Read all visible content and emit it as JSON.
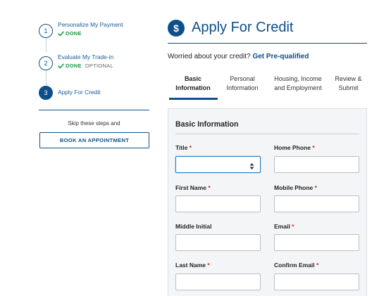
{
  "stepper": {
    "steps": [
      {
        "number": "1",
        "title": "Personalize My Payment",
        "status": "DONE",
        "optional": ""
      },
      {
        "number": "2",
        "title": "Evaluate My Trade-in",
        "status": "DONE",
        "optional": "OPTIONAL"
      },
      {
        "number": "3",
        "title": "Apply For Credit",
        "status": "",
        "optional": ""
      }
    ],
    "skip_text": "Skip these steps and",
    "appointment_button": "BOOK AN APPOINTMENT"
  },
  "header": {
    "icon_symbol": "$",
    "title": "Apply For Credit",
    "worried_text": "Worried about your credit?",
    "prequalified_link": "Get Pre-qualified"
  },
  "tabs": [
    {
      "line1": "Basic",
      "line2": "Information",
      "active": true
    },
    {
      "line1": "Personal",
      "line2": "Information",
      "active": false
    },
    {
      "line1": "Housing, Income",
      "line2": "and Employment",
      "active": false
    },
    {
      "line1": "Review &",
      "line2": "Submit",
      "active": false
    }
  ],
  "form": {
    "section_title": "Basic Information",
    "required_marker": "*",
    "fields": {
      "title": {
        "label": "Title",
        "value": ""
      },
      "home_phone": {
        "label": "Home Phone",
        "value": ""
      },
      "first_name": {
        "label": "First Name",
        "value": ""
      },
      "mobile_phone": {
        "label": "Mobile Phone",
        "value": ""
      },
      "middle_initial": {
        "label": "Middle Initial",
        "value": ""
      },
      "email": {
        "label": "Email",
        "value": ""
      },
      "last_name": {
        "label": "Last Name",
        "value": ""
      },
      "confirm_email": {
        "label": "Confirm Email",
        "value": ""
      }
    }
  },
  "colors": {
    "brand_blue": "#0e4f8a",
    "done_green": "#1c9a4b",
    "required_red": "#d11f1f",
    "focus_blue": "#1f7cc4"
  },
  "icons": [
    "check-icon",
    "dollar-icon",
    "select-arrows-icon"
  ]
}
